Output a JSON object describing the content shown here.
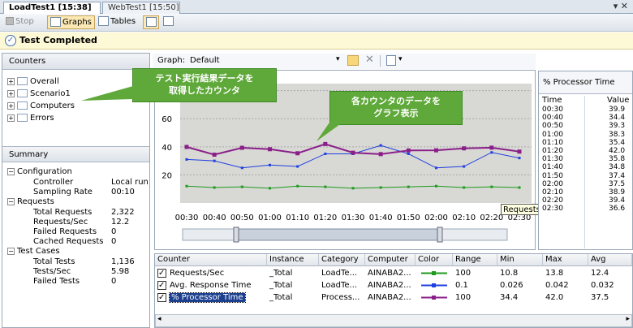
{
  "tabs": [
    {
      "label": "LoadTest1 [15:38]",
      "active": true
    },
    {
      "label": "WebTest1 [15:50]",
      "active": false
    }
  ],
  "toolbar": {
    "stop": "Stop",
    "graphs": "Graphs",
    "tables": "Tables"
  },
  "status": "Test Completed",
  "counters": {
    "title": "Counters",
    "items": [
      "Overall",
      "Scenario1",
      "Computers",
      "Errors"
    ]
  },
  "callout1": {
    "line1": "テスト実行結果データを",
    "line2": "取得したカウンタ"
  },
  "callout2": {
    "line1": "各カウンタのデータを",
    "line2": "グラフ表示"
  },
  "summary": {
    "title": "Summary",
    "configuration": "Configuration",
    "controller_label": "Controller",
    "controller_value": "Local run",
    "sampling_label": "Sampling Rate",
    "sampling_value": "00:10",
    "requests": "Requests",
    "total_requests_label": "Total Requests",
    "total_requests_value": "2,322",
    "rps_label": "Requests/Sec",
    "rps_value": "12.2",
    "failed_requests_label": "Failed Requests",
    "failed_requests_value": "0",
    "cached_requests_label": "Cached Requests",
    "cached_requests_value": "0",
    "test_cases": "Test Cases",
    "total_tests_label": "Total Tests",
    "total_tests_value": "1,136",
    "tps_label": "Tests/Sec",
    "tps_value": "5.98",
    "failed_tests_label": "Failed Tests",
    "failed_tests_value": "0"
  },
  "graph": {
    "label": "Graph:",
    "selected": "Default"
  },
  "tooltip": "Requests/Sec",
  "side_table": {
    "title": "% Processor Time",
    "col_time": "Time",
    "col_value": "Value",
    "rows": [
      [
        "00:30",
        "39.9"
      ],
      [
        "00:40",
        "34.4"
      ],
      [
        "00:50",
        "39.3"
      ],
      [
        "01:00",
        "38.3"
      ],
      [
        "01:10",
        "35.4"
      ],
      [
        "01:20",
        "42.0"
      ],
      [
        "01:30",
        "35.8"
      ],
      [
        "01:40",
        "34.8"
      ],
      [
        "01:50",
        "37.4"
      ],
      [
        "02:00",
        "37.5"
      ],
      [
        "02:10",
        "38.9"
      ],
      [
        "02:20",
        "39.4"
      ],
      [
        "02:30",
        "36.6"
      ]
    ]
  },
  "grid": {
    "headers": [
      "Counter",
      "Instance",
      "Category",
      "Computer",
      "Color",
      "Range",
      "Min",
      "Max",
      "Avg"
    ],
    "rows": [
      {
        "counter": "Requests/Sec",
        "instance": "_Total",
        "category": "LoadTe...",
        "computer": "AINABA2...",
        "color": "#1e9a1e",
        "range": "100",
        "min": "10.8",
        "max": "13.8",
        "avg": "12.4"
      },
      {
        "counter": "Avg. Response Time",
        "instance": "_Total",
        "category": "LoadTe...",
        "computer": "AINABA2...",
        "color": "#1f3fe0",
        "range": "0.1",
        "min": "0.026",
        "max": "0.042",
        "avg": "0.032"
      },
      {
        "counter": "% Processor Time",
        "instance": "_Total",
        "category": "Process...",
        "computer": "AINABA2...",
        "color": "#8a1f8a",
        "range": "100",
        "min": "34.4",
        "max": "42.0",
        "avg": "37.5"
      }
    ]
  },
  "chart_data": {
    "type": "line",
    "x": [
      "00:30",
      "00:40",
      "00:50",
      "01:00",
      "01:10",
      "01:20",
      "01:30",
      "01:40",
      "01:50",
      "02:00",
      "02:10",
      "02:20",
      "02:30"
    ],
    "ylim": [
      0,
      100
    ],
    "yticks": [
      "20",
      "40",
      "60",
      "80"
    ],
    "series": [
      {
        "name": "Requests/Sec",
        "color": "#1e9a1e",
        "values": [
          12,
          11,
          11.5,
          10.5,
          12,
          11.5,
          10.5,
          11,
          11.5,
          12,
          11,
          11.5,
          11
        ]
      },
      {
        "name": "Avg. Response Time",
        "color": "#1f3fe0",
        "values": [
          31,
          30,
          25,
          27,
          26,
          35,
          35,
          41,
          35,
          25,
          26,
          36,
          32
        ]
      },
      {
        "name": "% Processor Time",
        "color": "#8a1f8a",
        "values": [
          39.9,
          34.4,
          39.3,
          38.3,
          35.4,
          42.0,
          35.8,
          34.8,
          37.4,
          37.5,
          38.9,
          39.4,
          36.6
        ]
      }
    ]
  }
}
